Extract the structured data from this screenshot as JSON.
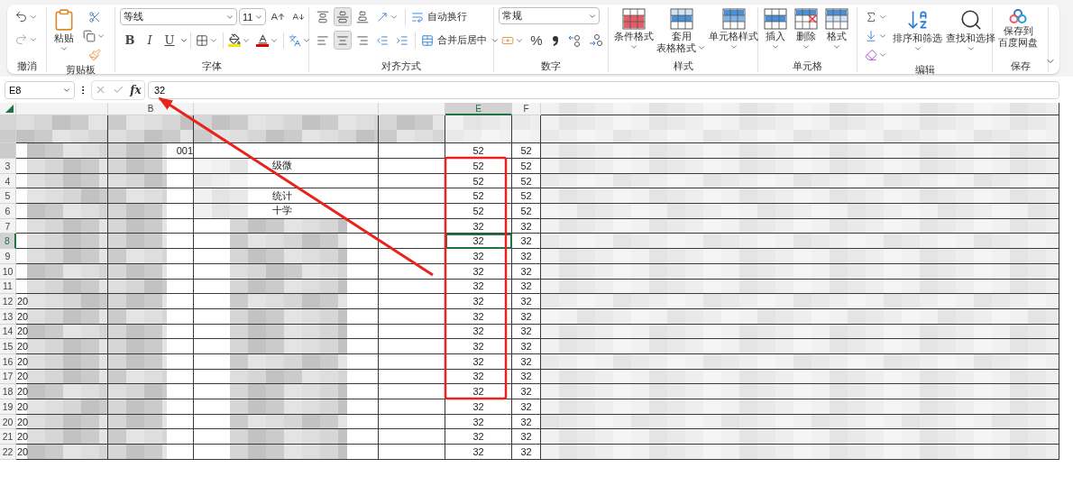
{
  "ribbon": {
    "groups": [
      {
        "kind": "undo",
        "label": "撤消"
      },
      {
        "kind": "clipboard",
        "label": "剪贴板",
        "paste": "粘贴"
      },
      {
        "kind": "font",
        "label": "字体",
        "font_name": "等线",
        "font_size": "11",
        "bold": "B",
        "italic": "I",
        "underline": "U"
      },
      {
        "kind": "alignment",
        "label": "对齐方式",
        "vertical": [
          {
            "selected": false
          },
          {
            "selected": true
          },
          {
            "selected": false
          }
        ],
        "horizontal": [
          {
            "selected": false
          },
          {
            "selected": true
          },
          {
            "selected": false
          }
        ],
        "wrap": "自动换行",
        "merge": "合并后居中"
      },
      {
        "kind": "number",
        "label": "数字",
        "format": "常规",
        "percent": "%"
      },
      {
        "kind": "styles",
        "label": "样式",
        "buttons": [
          {
            "lines": [
              "条件格式"
            ]
          },
          {
            "lines": [
              "套用",
              "表格格式"
            ]
          },
          {
            "lines": [
              "单元格样式"
            ]
          }
        ]
      },
      {
        "kind": "cells",
        "label": "单元格",
        "buttons": [
          {
            "lines": [
              "插入"
            ]
          },
          {
            "lines": [
              "删除"
            ]
          },
          {
            "lines": [
              "格式"
            ]
          }
        ]
      },
      {
        "kind": "editing",
        "label": "编辑",
        "buttons": [
          {
            "lines": [
              "排序和筛选"
            ]
          },
          {
            "lines": [
              "查找和选择"
            ]
          }
        ]
      },
      {
        "kind": "save",
        "label": "保存",
        "buttons": [
          {
            "lines": [
              "保存到",
              "百度网盘"
            ]
          }
        ]
      }
    ]
  },
  "formula_bar": {
    "name_box": "E8",
    "function_label": "fx",
    "formula": "32"
  },
  "sheet": {
    "columns": [
      {
        "selected": false
      },
      {
        "header": "B",
        "selected": false
      },
      {
        "selected": false
      },
      {
        "selected": false
      },
      {
        "header": "E",
        "selected": true
      },
      {
        "header": "F",
        "selected": false
      }
    ],
    "rows": [
      {
        "selected": false,
        "cells": {
          "b": "001",
          "e": "52",
          "f": "52"
        }
      },
      {
        "number": "3",
        "selected": false,
        "cells": {
          "c": "级微",
          "e": "52",
          "f": "52"
        }
      },
      {
        "number": "4",
        "selected": false,
        "cells": {
          "e": "52",
          "f": "52"
        }
      },
      {
        "number": "5",
        "selected": false,
        "cells": {
          "c": "统计",
          "e": "52",
          "f": "52"
        }
      },
      {
        "number": "6",
        "selected": false,
        "cells": {
          "c": "十学",
          "e": "52",
          "f": "52"
        }
      },
      {
        "number": "7",
        "selected": false,
        "cells": {
          "e": "32",
          "f": "32"
        }
      },
      {
        "number": "8",
        "selected": true,
        "cells": {
          "e": "32",
          "f": "32"
        }
      },
      {
        "number": "9",
        "selected": false,
        "cells": {
          "e": "32",
          "f": "32"
        }
      },
      {
        "number": "10",
        "selected": false,
        "cells": {
          "e": "32",
          "f": "32"
        }
      },
      {
        "number": "11",
        "selected": false,
        "cells": {
          "e": "32",
          "f": "32"
        }
      },
      {
        "number": "12",
        "selected": false,
        "cells": {
          "a": "20",
          "e": "32",
          "f": "32"
        }
      },
      {
        "number": "13",
        "selected": false,
        "cells": {
          "a": "20",
          "e": "32",
          "f": "32"
        }
      },
      {
        "number": "14",
        "selected": false,
        "cells": {
          "a": "20",
          "e": "32",
          "f": "32"
        }
      },
      {
        "number": "15",
        "selected": false,
        "cells": {
          "a": "20",
          "e": "32",
          "f": "32"
        }
      },
      {
        "number": "16",
        "selected": false,
        "cells": {
          "a": "20",
          "e": "32",
          "f": "32"
        }
      },
      {
        "number": "17",
        "selected": false,
        "cells": {
          "a": "20",
          "e": "32",
          "f": "32"
        }
      },
      {
        "number": "18",
        "selected": false,
        "cells": {
          "a": "20",
          "e": "32",
          "f": "32"
        }
      },
      {
        "number": "19",
        "selected": false,
        "cells": {
          "a": "20",
          "e": "32",
          "f": "32"
        }
      },
      {
        "number": "20",
        "selected": false,
        "cells": {
          "a": "20",
          "e": "32",
          "f": "32"
        }
      },
      {
        "number": "21",
        "selected": false,
        "cells": {
          "a": "20",
          "e": "32",
          "f": "32"
        }
      },
      {
        "number": "22",
        "selected": false,
        "cells": {
          "a": "20",
          "e": "32",
          "f": "32"
        }
      }
    ]
  }
}
